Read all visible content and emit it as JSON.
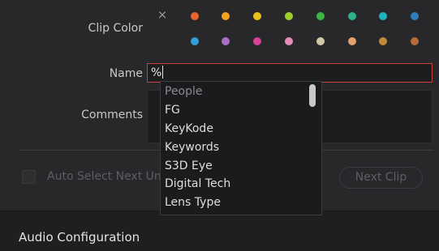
{
  "clip_color": {
    "label": "Clip Color",
    "clear_icon": "close-icon",
    "swatches_row1": [
      "#e8622c",
      "#f5a21c",
      "#e8c21a",
      "#9ecc2b",
      "#3fb547",
      "#2bb28a",
      "#20b3c0",
      "#2d7db8"
    ],
    "swatches_row2": [
      "#2e9fd8",
      "#a86fc4",
      "#d8419a",
      "#e58bb6",
      "#d3c9a8",
      "#e3a06c",
      "#c08a3a",
      "#b46a3c"
    ]
  },
  "name": {
    "label": "Name",
    "value": "%"
  },
  "comments": {
    "label": "Comments",
    "value": ""
  },
  "auto_select": {
    "label": "Auto Select Next Unreviewed Clip"
  },
  "next_clip_button": {
    "label": "Next Clip"
  },
  "section": {
    "title": "Audio Configuration"
  },
  "dropdown": {
    "items": [
      "People",
      "FG",
      "KeyKode",
      "Keywords",
      "S3D Eye",
      "Digital Tech",
      "Lens Type"
    ]
  }
}
